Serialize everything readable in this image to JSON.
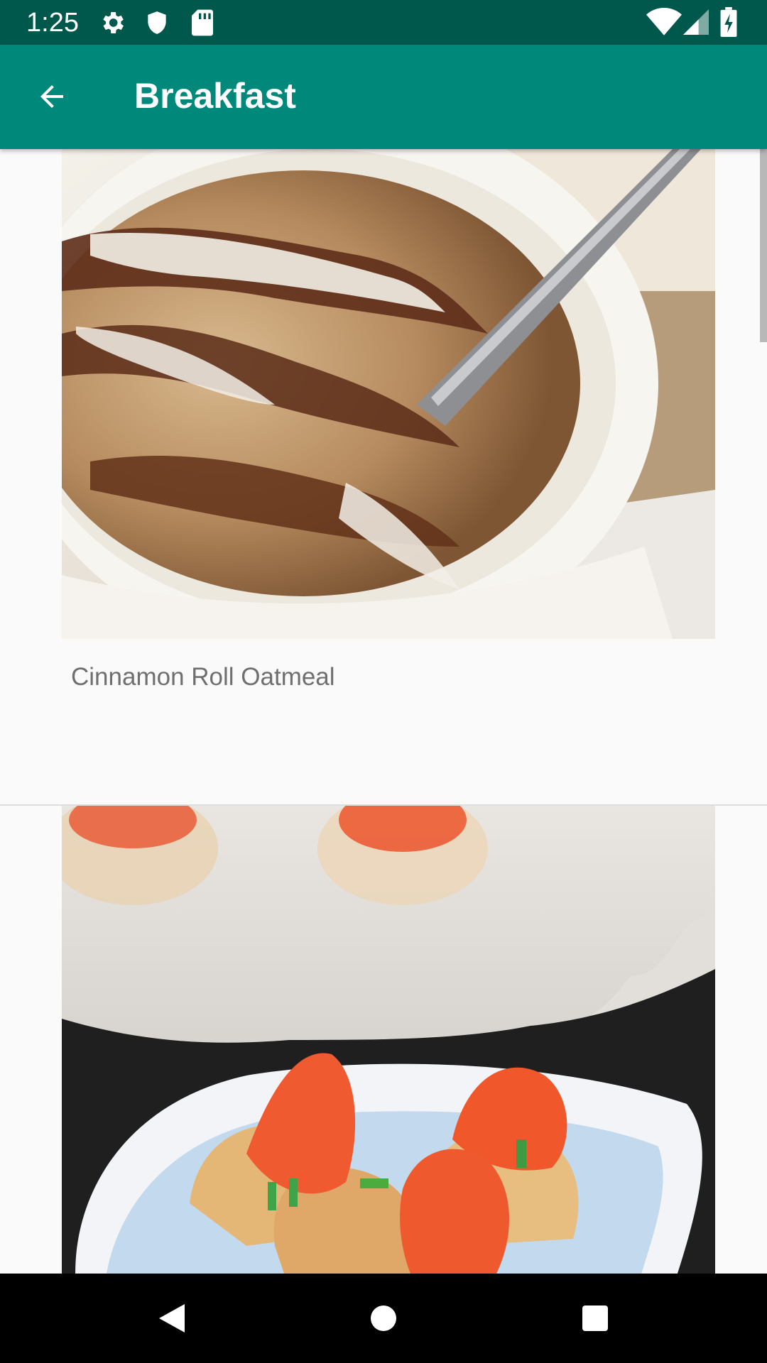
{
  "status_bar": {
    "time": "1:25",
    "icons": [
      "gear-icon",
      "shield-icon",
      "sd-card-icon",
      "wifi-icon",
      "cell-signal-icon",
      "battery-charging-icon"
    ]
  },
  "app_bar": {
    "title": "Breakfast",
    "back_icon": "arrow-back-icon"
  },
  "recipes": [
    {
      "title": "Cinnamon Roll Oatmeal",
      "image": "oatmeal-bowl-photo"
    },
    {
      "title": "",
      "image": "smoked-salmon-cups-photo"
    }
  ],
  "nav_bar": {
    "icons": [
      "back-triangle-icon",
      "home-circle-icon",
      "recents-square-icon"
    ]
  },
  "colors": {
    "status_bar": "#00574b",
    "app_bar": "#00897b",
    "background": "#fafafa",
    "caption_text": "#6f6f6f"
  }
}
